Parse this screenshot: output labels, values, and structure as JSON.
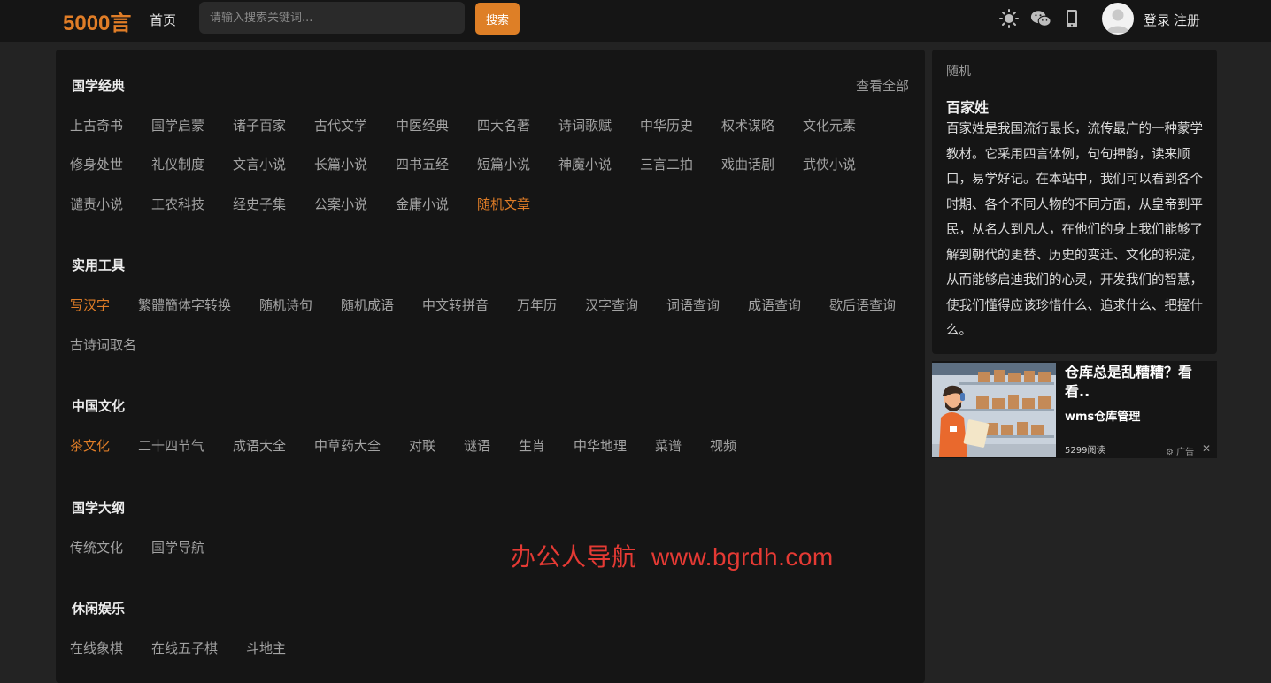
{
  "header": {
    "logo": "5000言",
    "nav_home": "首页",
    "search_placeholder": "请输入搜索关键词...",
    "search_button": "搜索",
    "login": "登录",
    "register": "注册",
    "icons": [
      "sun-icon",
      "wechat-icon",
      "mobile-icon",
      "user-avatar-icon"
    ]
  },
  "sections": {
    "guoxue": {
      "title": "国学经典",
      "view_all": "查看全部",
      "links": [
        "上古奇书",
        "国学启蒙",
        "诸子百家",
        "古代文学",
        "中医经典",
        "四大名著",
        "诗词歌赋",
        "中华历史",
        "权术谋略",
        "文化元素",
        "修身处世",
        "礼仪制度",
        "文言小说",
        "长篇小说",
        "四书五经",
        "短篇小说",
        "神魔小说",
        "三言二拍",
        "戏曲话剧",
        "武侠小说",
        "谴责小说",
        "工农科技",
        "经史子集",
        "公案小说",
        "金庸小说",
        "随机文章"
      ]
    },
    "tools": {
      "title": "实用工具",
      "links": [
        "写汉字",
        "繁體簡体字转换",
        "随机诗句",
        "随机成语",
        "中文转拼音",
        "万年历",
        "汉字查询",
        "词语查询",
        "成语查询",
        "歇后语查询",
        "古诗词取名"
      ]
    },
    "culture": {
      "title": "中国文化",
      "links": [
        "茶文化",
        "二十四节气",
        "成语大全",
        "中草药大全",
        "对联",
        "谜语",
        "生肖",
        "中华地理",
        "菜谱",
        "视频"
      ]
    },
    "outline": {
      "title": "国学大纲",
      "links": [
        "传统文化",
        "国学导航"
      ]
    },
    "leisure": {
      "title": "休闲娱乐",
      "links": [
        "在线象棋",
        "在线五子棋",
        "斗地主"
      ]
    }
  },
  "sidebar": {
    "label": "随机",
    "title": "百家姓",
    "description": "百家姓是我国流行最长，流传最广的一种蒙学教材。它采用四言体例，句句押韵，读来顺口，易学好记。在本站中，我们可以看到各个时期、各个不同人物的不同方面，从皇帝到平民，从名人到凡人，在他们的身上我们能够了解到朝代的更替、历史的变迁、文化的积淀，从而能够启迪我们的心灵，开发我们的智慧，使我们懂得应该珍惜什么、追求什么、把握什么。"
  },
  "ad": {
    "title": "仓库总是乱糟糟？看看..",
    "brand": "wms仓库管理",
    "reads": "5299阅读",
    "tag": "广告",
    "close": "✕"
  },
  "watermark": "办公人导航  www.bgrdh.com",
  "colors": {
    "accent": "#e07d27",
    "background": "#232323",
    "panel": "#151515",
    "watermark": "#e53a34"
  }
}
